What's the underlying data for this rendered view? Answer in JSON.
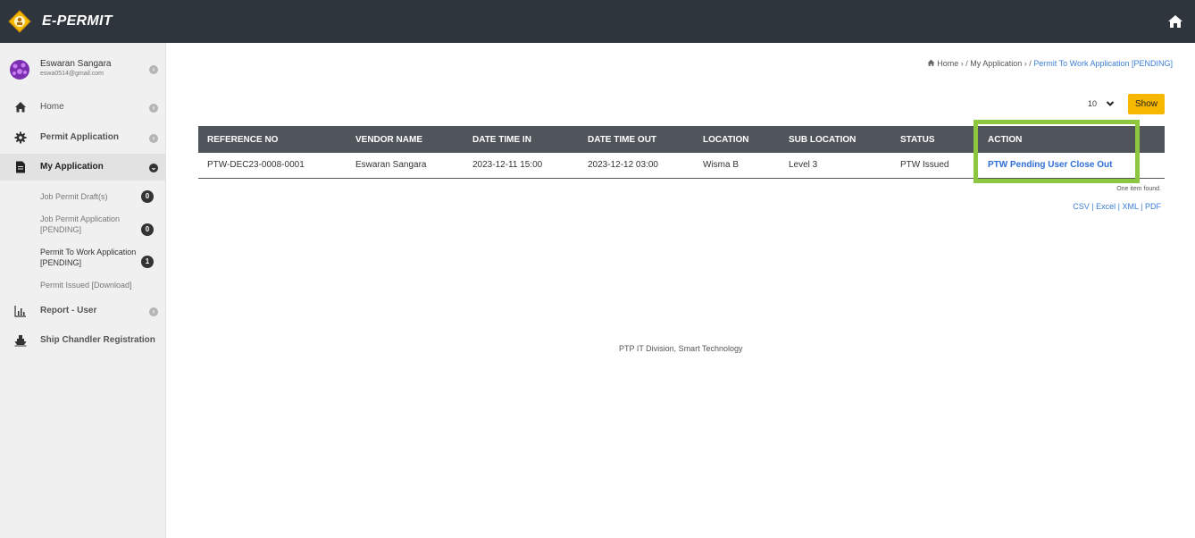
{
  "app": {
    "brand": "E-PERMIT"
  },
  "user": {
    "name": "Eswaran Sangara",
    "email": "eswa0514@gmail.com"
  },
  "nav": {
    "home": "Home",
    "permit_application": "Permit Application",
    "my_application": "My Application",
    "report_user": "Report - User",
    "ship_chandler": "Ship Chandler Registration"
  },
  "sub_nav": [
    {
      "label": "Job Permit Draft(s)",
      "count": "0"
    },
    {
      "label": "Job Permit Application [PENDING]",
      "count": "0"
    },
    {
      "label": "Permit To Work Application [PENDING]",
      "count": "1"
    },
    {
      "label": "Permit Issued [Download]"
    }
  ],
  "breadcrumb": {
    "home": "Home",
    "sep1": " › / ",
    "my_application": "My Application",
    "sep2": " › / ",
    "current": "Permit To Work Application [PENDING]"
  },
  "pagination": {
    "page_size": "10",
    "show_label": "Show"
  },
  "table": {
    "headers": [
      "REFERENCE NO",
      "VENDOR NAME",
      "DATE TIME IN",
      "DATE TIME OUT",
      "LOCATION",
      "SUB LOCATION",
      "STATUS",
      "ACTION"
    ],
    "rows": [
      [
        "PTW-DEC23-0008-0001",
        "Eswaran Sangara",
        "2023-12-11 15:00",
        "2023-12-12 03:00",
        "Wisma B",
        "Level 3",
        "PTW Issued",
        "PTW Pending User Close Out"
      ]
    ]
  },
  "found_text": "One item found.",
  "exports": {
    "csv": "CSV",
    "excel": "Excel",
    "xml": "XML",
    "pdf": "PDF",
    "sep": " | "
  },
  "footer": "PTP IT Division, Smart Technology",
  "colors": {
    "topbar": "#2e353d",
    "accent": "#f5b700",
    "highlight": "#8dc63f",
    "link": "#3b7fd9"
  }
}
